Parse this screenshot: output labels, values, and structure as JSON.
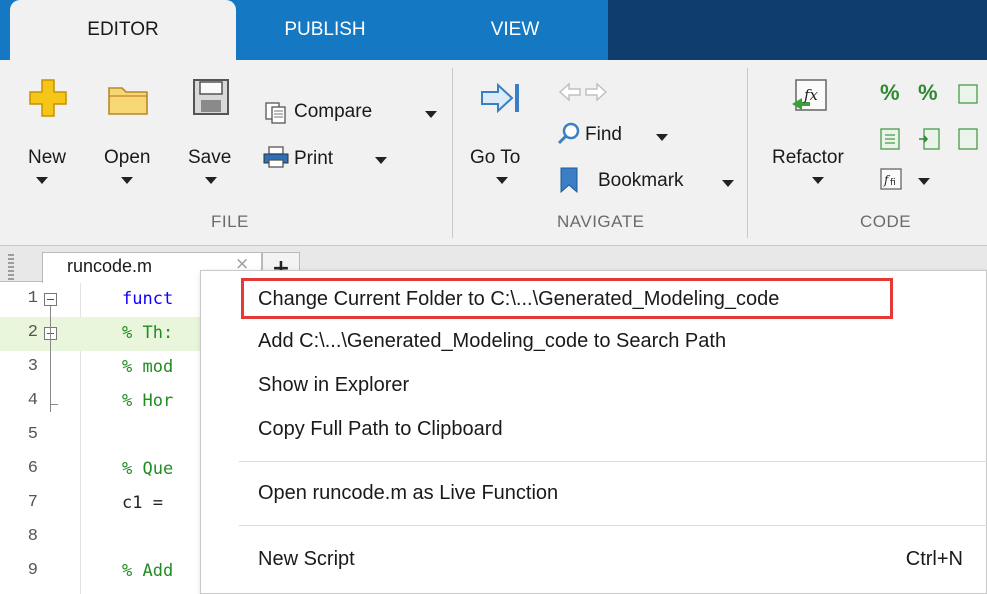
{
  "tabs": [
    {
      "label": "EDITOR",
      "active": true
    },
    {
      "label": "PUBLISH",
      "active": false
    },
    {
      "label": "VIEW",
      "active": false
    }
  ],
  "ribbon": {
    "file": {
      "group_label": "FILE",
      "new_label": "New",
      "open_label": "Open",
      "save_label": "Save",
      "compare_label": "Compare",
      "print_label": "Print"
    },
    "navigate": {
      "group_label": "NAVIGATE",
      "goto_label": "Go To",
      "find_label": "Find",
      "bookmark_label": "Bookmark"
    },
    "code": {
      "group_label": "CODE",
      "refactor_label": "Refactor",
      "percent_glyph": "%"
    }
  },
  "editor": {
    "file_tab": "runcode.m",
    "close_glyph": "×",
    "add_tab_glyph": "+",
    "lines": [
      {
        "n": "1",
        "text": "funct"
      },
      {
        "n": "2",
        "text": "% Th:"
      },
      {
        "n": "3",
        "text": "% mod"
      },
      {
        "n": "4",
        "text": "% Hor"
      },
      {
        "n": "5",
        "text": ""
      },
      {
        "n": "6",
        "text": "% Que"
      },
      {
        "n": "7",
        "text": "c1 ="
      },
      {
        "n": "8",
        "text": ""
      },
      {
        "n": "9",
        "text": "% Add"
      }
    ]
  },
  "context_menu": {
    "items": [
      {
        "label": "Change Current Folder to C:\\...\\Generated_Modeling_code",
        "shortcut": ""
      },
      {
        "label": "Add C:\\...\\Generated_Modeling_code to Search Path",
        "shortcut": ""
      },
      {
        "label": "Show in Explorer",
        "shortcut": ""
      },
      {
        "label": "Copy Full Path to Clipboard",
        "shortcut": ""
      },
      {
        "label": "Open runcode.m as Live Function",
        "shortcut": ""
      },
      {
        "label": "New Script",
        "shortcut": "Ctrl+N"
      }
    ]
  },
  "colors": {
    "tab_bar": "#1479c2",
    "tab_bar_dark": "#0f3d6e",
    "ribbon_bg": "#f1f1f1",
    "highlight_box": "#e53935",
    "comment": "#228b22",
    "keyword": "#0e00ff"
  }
}
